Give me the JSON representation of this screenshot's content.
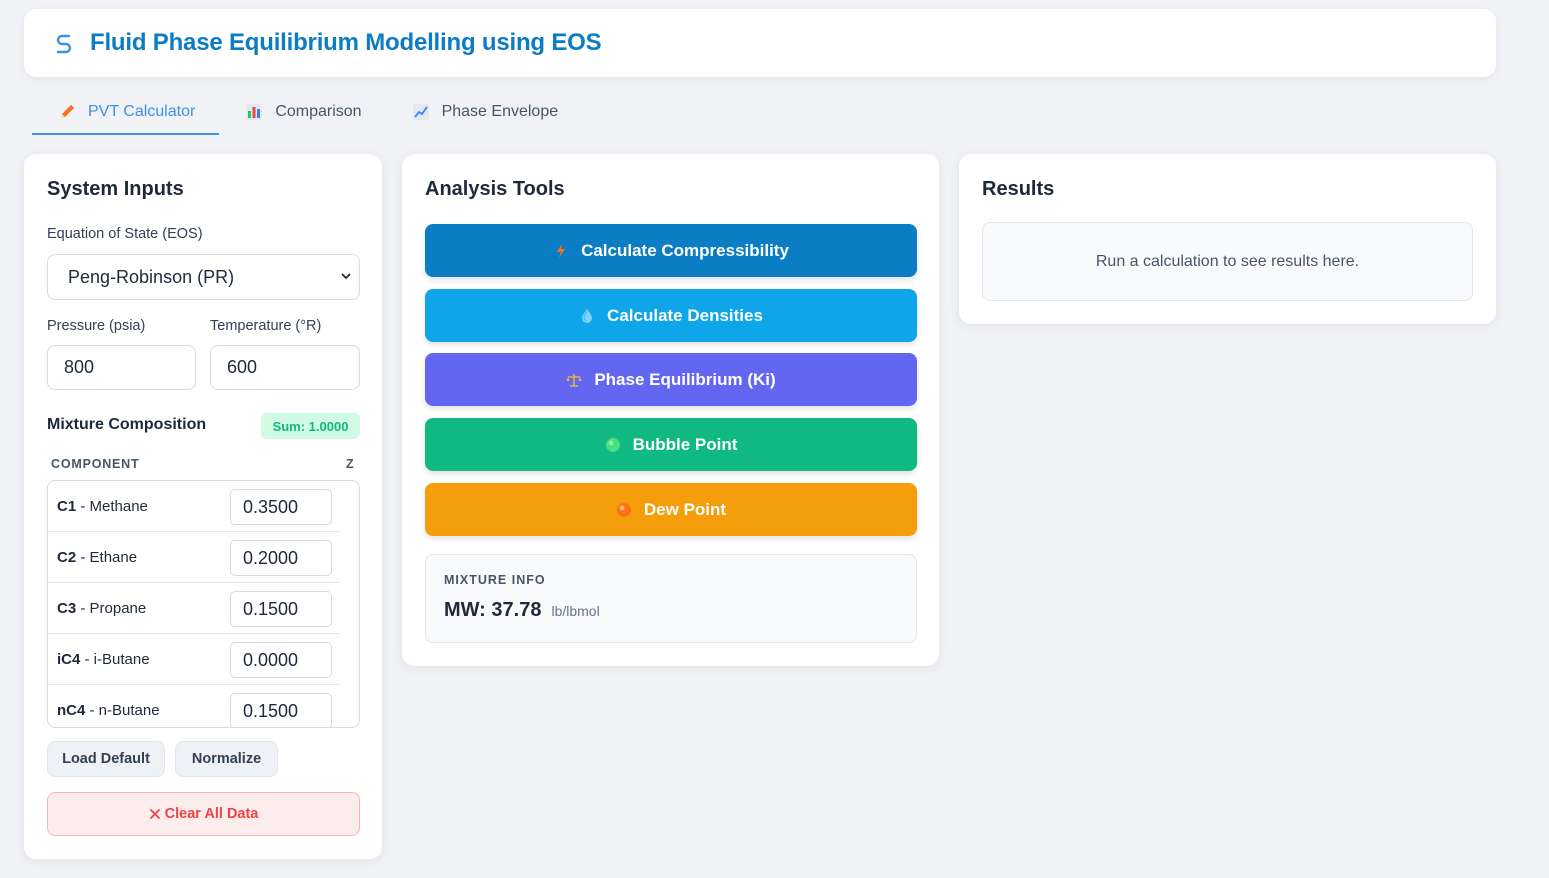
{
  "app": {
    "title": "Fluid Phase Equilibrium Modelling using EOS"
  },
  "tabs": [
    {
      "label": "PVT Calculator",
      "active": true,
      "icon": "pencil-icon"
    },
    {
      "label": "Comparison",
      "active": false,
      "icon": "bar-chart-icon"
    },
    {
      "label": "Phase Envelope",
      "active": false,
      "icon": "line-chart-icon"
    }
  ],
  "inputs": {
    "title": "System Inputs",
    "eos_label": "Equation of State (EOS)",
    "eos_value": "Peng-Robinson (PR)",
    "pressure_label": "Pressure (psia)",
    "pressure_value": "800",
    "temperature_label": "Temperature (°R)",
    "temperature_value": "600",
    "mixture_label": "Mixture Composition",
    "sum_badge": "Sum: 1.0000",
    "col_component": "COMPONENT",
    "col_z": "Z",
    "components": [
      {
        "code": "C1",
        "name": "- Methane",
        "z": "0.3500"
      },
      {
        "code": "C2",
        "name": "- Ethane",
        "z": "0.2000"
      },
      {
        "code": "C3",
        "name": "- Propane",
        "z": "0.1500"
      },
      {
        "code": "iC4",
        "name": "- i-Butane",
        "z": "0.0000"
      },
      {
        "code": "nC4",
        "name": "- n-Butane",
        "z": "0.1500"
      }
    ],
    "load_default": "Load Default",
    "normalize": "Normalize",
    "clear_all": "Clear All Data"
  },
  "tools": {
    "title": "Analysis Tools",
    "buttons": [
      {
        "label": "Calculate Compressibility",
        "color": "#0b7dc4",
        "icon": "lightning-icon"
      },
      {
        "label": "Calculate Densities",
        "color": "#0ea5e9",
        "icon": "droplet-icon"
      },
      {
        "label": "Phase Equilibrium (Ki)",
        "color": "#6366f1",
        "icon": "scales-icon"
      },
      {
        "label": "Bubble Point",
        "color": "#10b981",
        "icon": "green-circle-icon"
      },
      {
        "label": "Dew Point",
        "color": "#f59e0b",
        "icon": "orange-circle-icon"
      }
    ],
    "mixture_info_label": "MIXTURE INFO",
    "mw_text": "MW: 37.78",
    "mw_unit": "lb/lbmol"
  },
  "results": {
    "title": "Results",
    "placeholder": "Run a calculation to see results here."
  },
  "colors": {
    "accent": "#0b7dc4",
    "tab_active": "#3b92e6",
    "success": "#10b981",
    "danger": "#ef4444"
  }
}
